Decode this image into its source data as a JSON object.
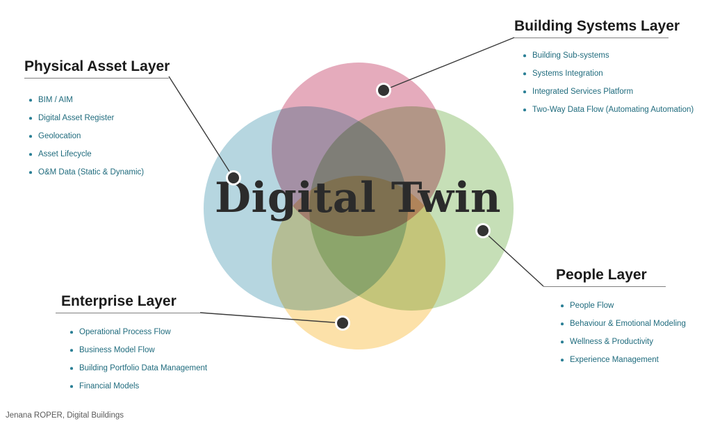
{
  "center": {
    "title": "Digital Twin"
  },
  "footer": {
    "credit": "Jenana ROPER, Digital Buildings"
  },
  "colors": {
    "circle_physical": "#a9cfdb",
    "circle_building": "#e6a9bb",
    "circle_people": "#c3ddb3",
    "circle_enterprise": "#fbe0a4",
    "bullet_text": "#1f6b7d",
    "heading_text": "#1b1b1b",
    "rule": "#808080",
    "leader_line": "#3a3a3a",
    "leader_dot": "#333333",
    "center_title": "#2b2b2b",
    "footer_text": "#5a5a5a"
  },
  "blocks": [
    {
      "id": "physical",
      "heading": "Physical Asset Layer",
      "items": [
        "BIM / AIM",
        "Digital Asset Register",
        "Geolocation",
        "Asset Lifecycle",
        "O&M Data (Static & Dynamic)"
      ]
    },
    {
      "id": "building",
      "heading": "Building Systems Layer",
      "items": [
        "Building Sub-systems",
        "Systems Integration",
        "Integrated Services Platform",
        "Two-Way Data Flow (Automating Automation)"
      ]
    },
    {
      "id": "people",
      "heading": "People Layer",
      "items": [
        "People Flow",
        "Behaviour & Emotional Modeling",
        "Wellness & Productivity",
        "Experience Management"
      ]
    },
    {
      "id": "enterprise",
      "heading": "Enterprise Layer",
      "items": [
        "Operational Process Flow",
        "Business Model Flow",
        "Building Portfolio Data Management",
        "Financial Models"
      ]
    }
  ]
}
